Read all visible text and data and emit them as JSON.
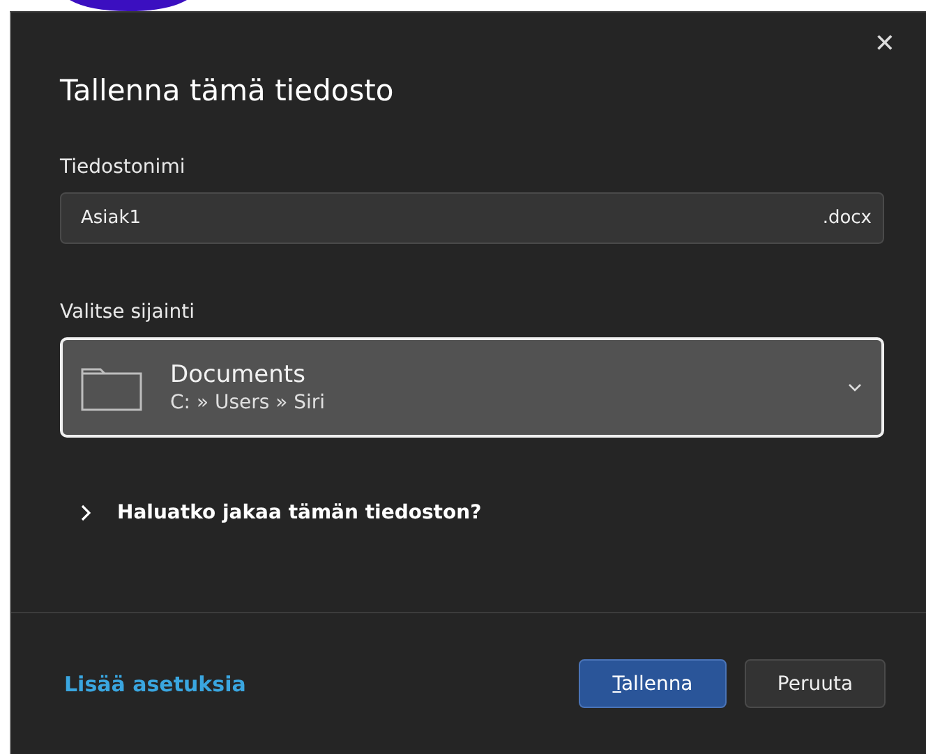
{
  "dialog": {
    "title": "Tallenna tämä tiedosto",
    "close": "✕"
  },
  "filename": {
    "label": "Tiedostonimi",
    "value": "Asiak1",
    "extension": ".docx"
  },
  "location": {
    "label": "Valitse sijainti",
    "folder": "Documents",
    "path": "C: » Users » Siri",
    "selected": true
  },
  "share": {
    "label": "Haluatko jakaa tämän tiedoston?",
    "expanded": false
  },
  "footer": {
    "link": "Lisää asetuksia",
    "buttons": [
      {
        "label": "Tallenna",
        "kind": "primary"
      },
      {
        "label": "Peruuta",
        "kind": "secondary"
      }
    ]
  }
}
